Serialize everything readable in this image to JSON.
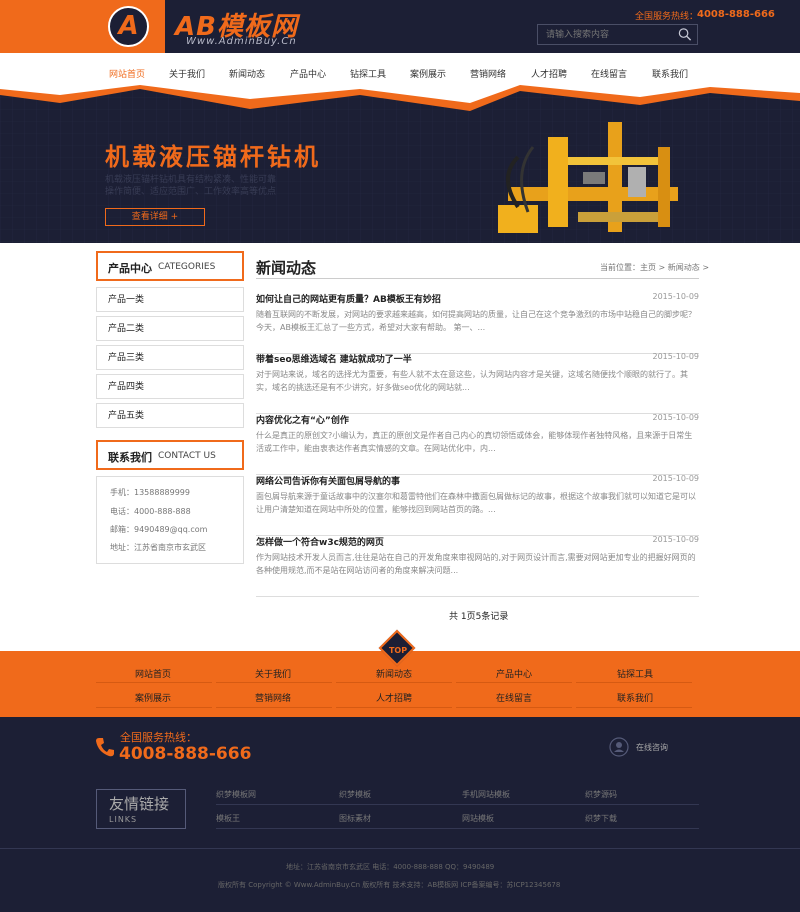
{
  "header": {
    "logo_letter": "A",
    "logo_title": "AB模板网",
    "logo_sub": "Www.AdminBuy.Cn",
    "hotline_label": "全国服务热线：",
    "hotline_number": "4008-888-666",
    "search_placeholder": "请输入搜索内容"
  },
  "nav": {
    "items": [
      "网站首页",
      "关于我们",
      "新闻动态",
      "产品中心",
      "钻探工具",
      "案例展示",
      "营销网络",
      "人才招聘",
      "在线留言",
      "联系我们"
    ]
  },
  "banner": {
    "title": "机载液压锚杆钻机",
    "ghost_line1": "机载液压锚杆钻机具有结构紧凑、性能可靠",
    "ghost_line2": "操作简便、适应范围广、工作效率高等优点",
    "button": "查看详细 +"
  },
  "sidebar": {
    "products_cn": "产品中心",
    "products_en": "CATEGORIES",
    "categories": [
      "产品一类",
      "产品二类",
      "产品三类",
      "产品四类",
      "产品五类"
    ],
    "contact_cn": "联系我们",
    "contact_en": "CONTACT US",
    "contact_lines": [
      "手机：13588889999",
      "电话：4000-888-888",
      "邮箱：9490489@qq.com",
      "地址：江苏省南京市玄武区"
    ]
  },
  "news": {
    "title": "新闻动态",
    "breadcrumb": "当前位置：主页 > 新闻动态 >",
    "items": [
      {
        "title": "如何让自己的网站更有质量？AB模板王有妙招",
        "date": "2015-10-09",
        "summary": "随着互联网的不断发展，对网站的要求越来越高，如何提高网站的质量，让自己在这个竞争激烈的市场中站稳自己的脚步呢？今天，AB模板王汇总了一些方式，希望对大家有帮助。 第一、..."
      },
      {
        "title": "带着seo思维选域名 建站就成功了一半",
        "date": "2015-10-09",
        "summary": "对于网站来说，域名的选择尤为重要，有些人就不太在意这些，认为网站内容才是关键，这域名随便找个顺眼的就行了。其实，域名的挑选还是有不少讲究，好多做seo优化的网站就..."
      },
      {
        "title": "内容优化之有“心”创作",
        "date": "2015-10-09",
        "summary": "什么是真正的原创文?小编认为，真正的原创文是作者自己内心的真切领悟或体会，能够体现作者独特风格，且来源于日常生活或工作中，能由衷表达作者真实情感的文章。在网站优化中，内..."
      },
      {
        "title": "网络公司告诉你有关面包屑导航的事",
        "date": "2015-10-09",
        "summary": "面包屑导航来源于童话故事中的汉塞尔和葛雷特他们在森林中撒面包屑做标记的故事，根据这个故事我们就可以知道它是可以让用户清楚知道在网站中所处的位置，能够找回到网站首页的路。..."
      },
      {
        "title": "怎样做一个符合w3c规范的网页",
        "date": "2015-10-09",
        "summary": "作为网站技术开发人员而言,往往是站在自己的开发角度来审视网站的,对于网页设计而言,需要对网站更加专业的把握好网页的各种使用规范,而不是站在网站访问者的角度来解决问题..."
      }
    ],
    "pager": "共 1页5条记录"
  },
  "footer_nav": {
    "top": "TOP",
    "row1": [
      "网站首页",
      "关于我们",
      "新闻动态",
      "产品中心",
      "钻探工具"
    ],
    "row2": [
      "案例展示",
      "营销网络",
      "人才招聘",
      "在线留言",
      "联系我们"
    ]
  },
  "bottom": {
    "hot_label": "全国服务热线：",
    "hot_number": "4008-888-666",
    "online": "在线咨询",
    "links_cn": "友情链接",
    "links_en": "LINKS",
    "links": [
      "织梦模板网",
      "织梦模板",
      "手机网站模板",
      "织梦源码",
      "模板王",
      "图标素材",
      "网站模板",
      "织梦下载"
    ],
    "copy1": "地址：江苏省南京市玄武区   电话：4000-888-888   QQ：9490489",
    "copy2": "版权所有 Copyright © Www.AdminBuy.Cn 版权所有   技术支持：AB模板网   ICP备案编号：苏ICP12345678"
  },
  "colors": {
    "accent": "#f06a1b",
    "dark": "#1c1f35"
  }
}
